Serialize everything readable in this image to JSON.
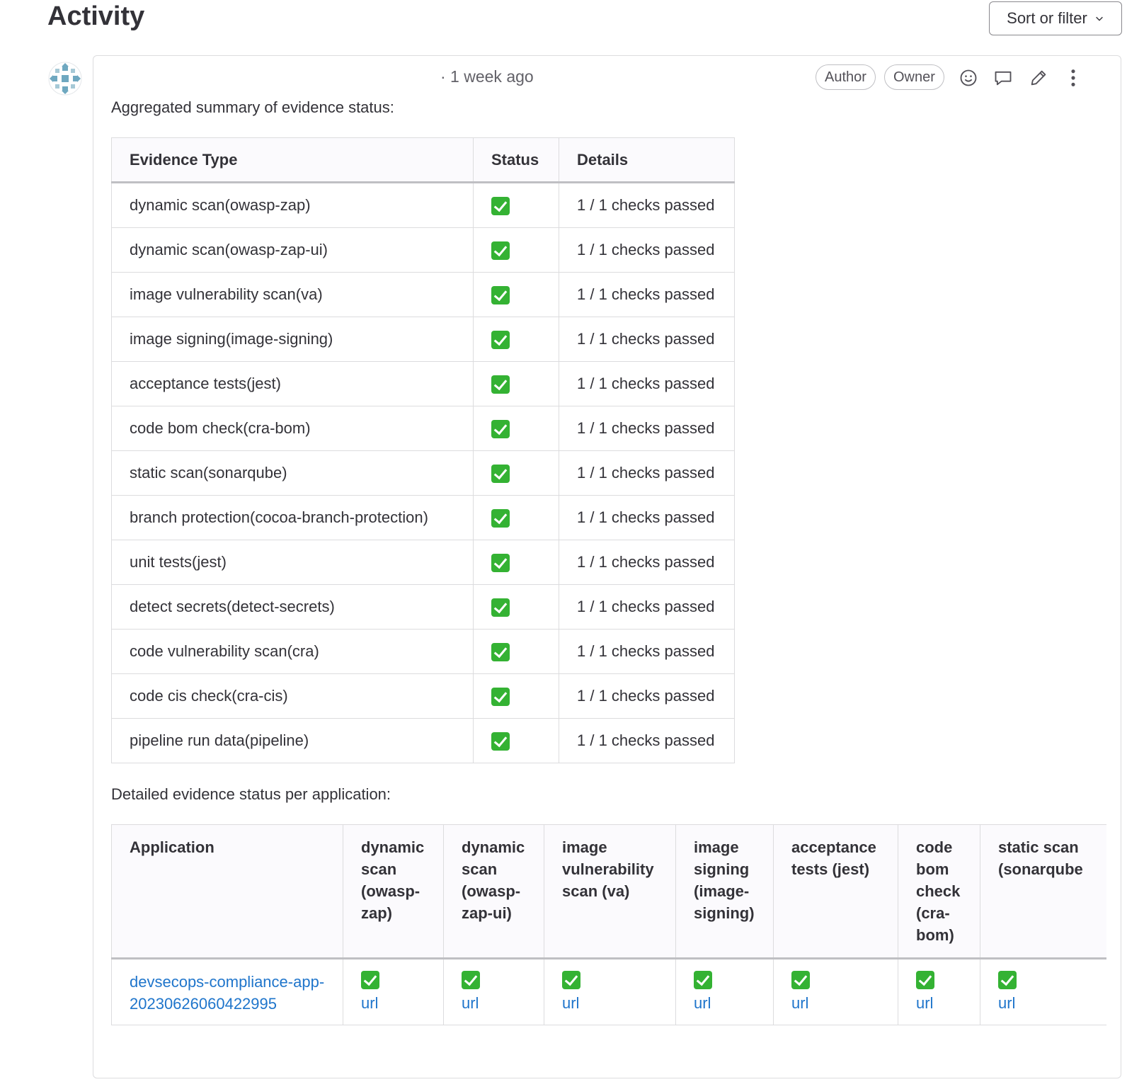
{
  "page": {
    "title": "Activity",
    "sort_label": "Sort or filter"
  },
  "note": {
    "time": "· 1 week ago",
    "badges": [
      "Author",
      "Owner"
    ],
    "intro": "Aggregated summary of evidence status:",
    "detail_intro": "Detailed evidence status per application:"
  },
  "summary_table": {
    "headers": [
      "Evidence Type",
      "Status",
      "Details"
    ],
    "rows": [
      {
        "type": "dynamic scan(owasp-zap)",
        "status": "passed",
        "details": "1 / 1 checks passed"
      },
      {
        "type": "dynamic scan(owasp-zap-ui)",
        "status": "passed",
        "details": "1 / 1 checks passed"
      },
      {
        "type": "image vulnerability scan(va)",
        "status": "passed",
        "details": "1 / 1 checks passed"
      },
      {
        "type": "image signing(image-signing)",
        "status": "passed",
        "details": "1 / 1 checks passed"
      },
      {
        "type": "acceptance tests(jest)",
        "status": "passed",
        "details": "1 / 1 checks passed"
      },
      {
        "type": "code bom check(cra-bom)",
        "status": "passed",
        "details": "1 / 1 checks passed"
      },
      {
        "type": "static scan(sonarqube)",
        "status": "passed",
        "details": "1 / 1 checks passed"
      },
      {
        "type": "branch protection(cocoa-branch-protection)",
        "status": "passed",
        "details": "1 / 1 checks passed"
      },
      {
        "type": "unit tests(jest)",
        "status": "passed",
        "details": "1 / 1 checks passed"
      },
      {
        "type": "detect secrets(detect-secrets)",
        "status": "passed",
        "details": "1 / 1 checks passed"
      },
      {
        "type": "code vulnerability scan(cra)",
        "status": "passed",
        "details": "1 / 1 checks passed"
      },
      {
        "type": "code cis check(cra-cis)",
        "status": "passed",
        "details": "1 / 1 checks passed"
      },
      {
        "type": "pipeline run data(pipeline)",
        "status": "passed",
        "details": "1 / 1 checks passed"
      }
    ]
  },
  "detail_table": {
    "headers": [
      "Application",
      "dynamic scan (owasp-zap)",
      "dynamic scan (owasp-zap-ui)",
      "image vulnerability scan (va)",
      "image signing (image-signing)",
      "acceptance tests (jest)",
      "code bom check (cra-bom)",
      "static scan (sonarqube"
    ],
    "rows": [
      {
        "application": "devsecops-compliance-app-20230626060422995",
        "cells": [
          {
            "status": "passed",
            "link": "url"
          },
          {
            "status": "passed",
            "link": "url"
          },
          {
            "status": "passed",
            "link": "url"
          },
          {
            "status": "passed",
            "link": "url"
          },
          {
            "status": "passed",
            "link": "url"
          },
          {
            "status": "passed",
            "link": "url"
          },
          {
            "status": "passed",
            "link": "url"
          }
        ]
      }
    ]
  },
  "icons": {
    "avatar": "identicon-avatar",
    "actions": [
      "smiley-icon",
      "comment-icon",
      "pencil-icon",
      "kebab-menu-icon"
    ]
  },
  "colors": {
    "link": "#1f75cb",
    "check": "#34b233"
  }
}
